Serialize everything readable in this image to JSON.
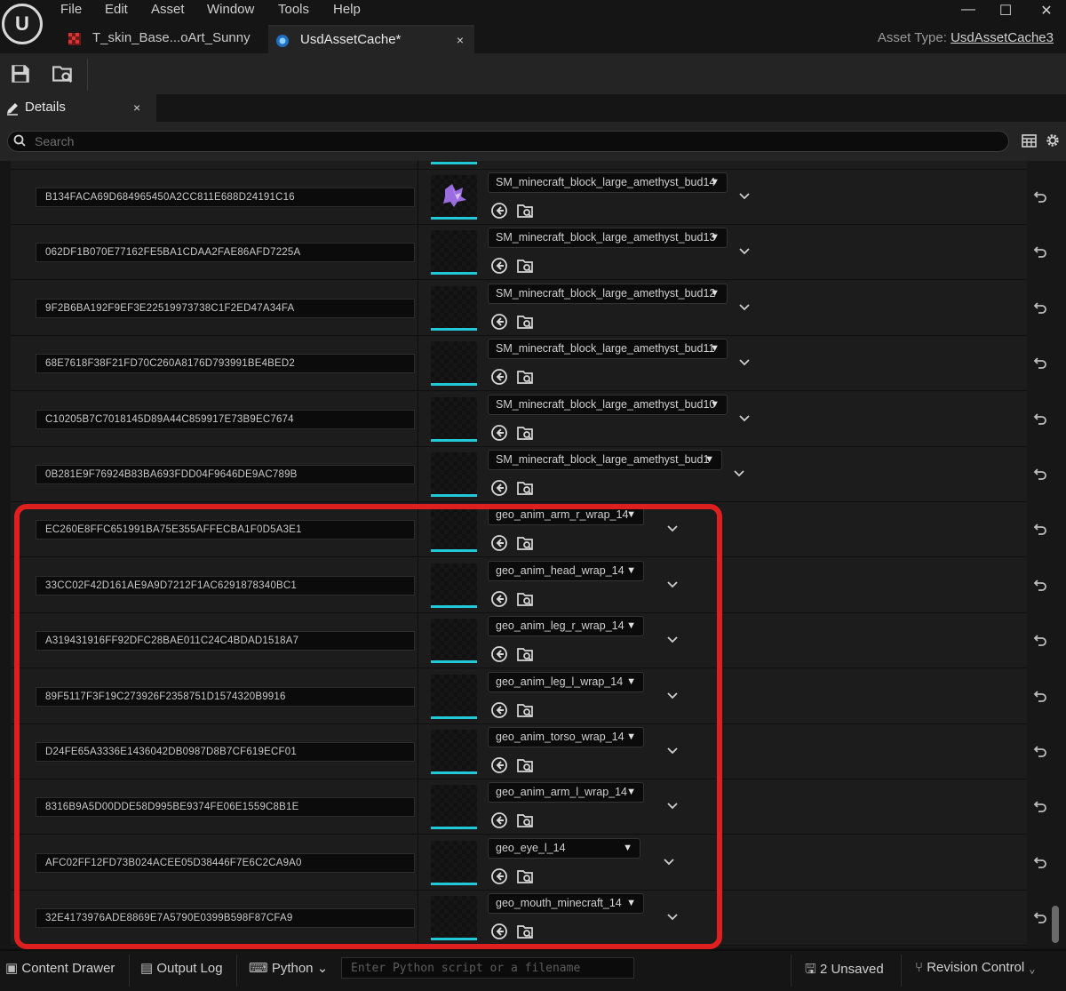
{
  "menu": [
    "File",
    "Edit",
    "Asset",
    "Window",
    "Tools",
    "Help"
  ],
  "window_controls": {
    "minimize": "—",
    "maximize": "☐",
    "close": "✕"
  },
  "tabs": [
    {
      "label": "T_skin_Base...oArt_Sunny",
      "icon": "texture-icon"
    },
    {
      "label": "UsdAssetCache*",
      "icon": "usd-asset-icon",
      "close": "×"
    }
  ],
  "asset_type": {
    "label": "Asset Type:",
    "value": "UsdAssetCache3"
  },
  "details_tab": {
    "label": "Details",
    "close": "×"
  },
  "search": {
    "placeholder": "Search"
  },
  "rows": [
    {
      "hash": "B134FACA69D684965450A2CC811E688D24191C16",
      "asset": "SM_minecraft_block_large_amethyst_bud14",
      "thumb": "amethyst"
    },
    {
      "hash": "062DF1B070E77162FE5BA1CDAA2FAE86AFD7225A",
      "asset": "SM_minecraft_block_large_amethyst_bud13",
      "thumb": "empty"
    },
    {
      "hash": "9F2B6BA192F9EF3E22519973738C1F2ED47A34FA",
      "asset": "SM_minecraft_block_large_amethyst_bud12",
      "thumb": "empty"
    },
    {
      "hash": "68E7618F38F21FD70C260A8176D793991BE4BED2",
      "asset": "SM_minecraft_block_large_amethyst_bud11",
      "thumb": "empty"
    },
    {
      "hash": "C10205B7C7018145D89A44C859917E73B9EC7674",
      "asset": "SM_minecraft_block_large_amethyst_bud10",
      "thumb": "empty"
    },
    {
      "hash": "0B281E9F76924B83BA693FDD04F9646DE9AC789B",
      "asset": "SM_minecraft_block_large_amethyst_bud1",
      "thumb": "empty"
    },
    {
      "hash": "EC260E8FFC651991BA75E355AFFECBA1F0D5A3E1",
      "asset": "geo_anim_arm_r_wrap_14",
      "thumb": "empty"
    },
    {
      "hash": "33CC02F42D161AE9A9D7212F1AC6291878340BC1",
      "asset": "geo_anim_head_wrap_14",
      "thumb": "empty"
    },
    {
      "hash": "A319431916FF92DFC28BAE011C24C4BDAD1518A7",
      "asset": "geo_anim_leg_r_wrap_14",
      "thumb": "empty"
    },
    {
      "hash": "89F5117F3F19C273926F2358751D1574320B9916",
      "asset": "geo_anim_leg_l_wrap_14",
      "thumb": "empty"
    },
    {
      "hash": "D24FE65A3336E1436042DB0987D8B7CF619ECF01",
      "asset": "geo_anim_torso_wrap_14",
      "thumb": "empty"
    },
    {
      "hash": "8316B9A5D00DDE58D995BE9374FE06E1559C8B1E",
      "asset": "geo_anim_arm_l_wrap_14",
      "thumb": "empty"
    },
    {
      "hash": "AFC02FF12FD73B024ACEE05D38446F7E6C2CA9A0",
      "asset": "geo_eye_l_14",
      "thumb": "empty"
    },
    {
      "hash": "32E4173976ADE8869E7A5790E0399B598F87CFA9",
      "asset": "geo_mouth_minecraft_14",
      "thumb": "empty"
    }
  ],
  "statusbar": {
    "content_drawer": "Content Drawer",
    "output_log": "Output Log",
    "python": "Python",
    "python_placeholder": "Enter Python script or a filename",
    "unsaved": "2 Unsaved",
    "revision_control": "Revision Control"
  },
  "colors": {
    "accent": "#21c8d8",
    "annotation": "#dd1f1f",
    "background": "#151515"
  }
}
